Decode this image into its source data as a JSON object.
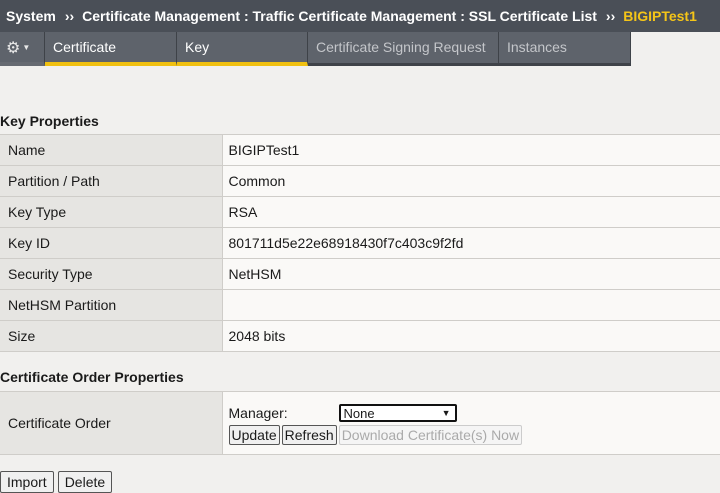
{
  "breadcrumb": {
    "root": "System",
    "path": "Certificate Management : Traffic Certificate Management : SSL Certificate List",
    "current": "BIGIPTest1",
    "separator": "››"
  },
  "tabs": {
    "gear_icon": "⚙",
    "items": [
      {
        "label": "Certificate",
        "state": "selected"
      },
      {
        "label": "Key",
        "state": "selected"
      },
      {
        "label": "Certificate Signing Request",
        "state": "disabled"
      },
      {
        "label": "Instances",
        "state": "disabled"
      }
    ]
  },
  "key_properties": {
    "title": "Key Properties",
    "rows": [
      {
        "label": "Name",
        "value": "BIGIPTest1"
      },
      {
        "label": "Partition / Path",
        "value": "Common"
      },
      {
        "label": "Key Type",
        "value": "RSA"
      },
      {
        "label": "Key ID",
        "value": "801711d5e22e68918430f7c403c9f2fd"
      },
      {
        "label": "Security Type",
        "value": "NetHSM"
      },
      {
        "label": "NetHSM Partition",
        "value": ""
      },
      {
        "label": "Size",
        "value": "2048 bits"
      }
    ]
  },
  "order_properties": {
    "title": "Certificate Order Properties",
    "row_label": "Certificate Order",
    "manager_label": "Manager:",
    "manager_value": "None",
    "update_label": "Update",
    "refresh_label": "Refresh",
    "download_label": "Download Certificate(s) Now"
  },
  "footer": {
    "import_label": "Import",
    "delete_label": "Delete"
  },
  "colors": {
    "header_bg": "#4a4f57",
    "accent": "#f5c518",
    "tab_bg": "#5e636b"
  }
}
